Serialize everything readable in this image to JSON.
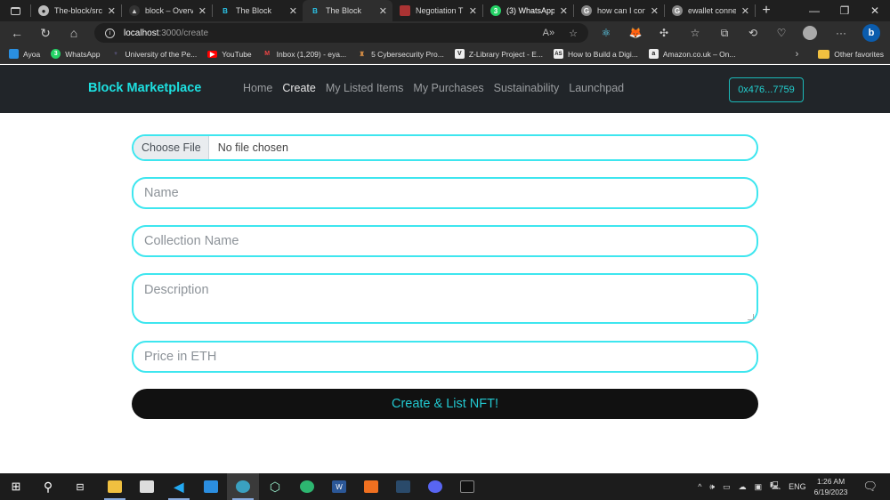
{
  "browser": {
    "tabs": [
      {
        "label": "The-block/src",
        "icon": "github-icon",
        "active": false
      },
      {
        "label": "block – Overv",
        "icon": "vercel-icon",
        "active": false
      },
      {
        "label": "The Block",
        "icon": "block-b-icon",
        "active": false
      },
      {
        "label": "The Block",
        "icon": "block-b-icon",
        "active": true
      },
      {
        "label": "Negotiation T",
        "icon": "doc-icon",
        "active": false
      },
      {
        "label": "(3) WhatsApp",
        "icon": "whatsapp-icon",
        "active": false
      },
      {
        "label": "how can I con",
        "icon": "google-icon",
        "active": false
      },
      {
        "label": "ewallet conne",
        "icon": "google-icon",
        "active": false
      }
    ],
    "url_host": "localhost",
    "url_path": ":3000/create",
    "bookmarks": [
      {
        "label": "Ayoa",
        "color": "#2a8fe0"
      },
      {
        "label": "WhatsApp",
        "color": "#25d366"
      },
      {
        "label": "University of the Pe...",
        "color": "#8a7fd0"
      },
      {
        "label": "YouTube",
        "color": "#ff0000"
      },
      {
        "label": "Inbox (1,209) - eya...",
        "color": "#d44"
      },
      {
        "label": "5 Cybersecurity Pro...",
        "color": "#c84"
      },
      {
        "label": "Z-Library Project - E...",
        "color": "#eee"
      },
      {
        "label": "How to Build a Digi...",
        "color": "#eee"
      },
      {
        "label": "Amazon.co.uk – On...",
        "color": "#eee"
      }
    ],
    "other_favorites": "Other favorites"
  },
  "site": {
    "brand": "Block Marketplace",
    "nav": [
      {
        "label": "Home",
        "current": false
      },
      {
        "label": "Create",
        "current": true
      },
      {
        "label": "My Listed Items",
        "current": false
      },
      {
        "label": "My Purchases",
        "current": false
      },
      {
        "label": "Sustainability",
        "current": false
      },
      {
        "label": "Launchpad",
        "current": false
      }
    ],
    "wallet": "0x476...7759",
    "accent": "#1de0e0"
  },
  "form": {
    "file_button": "Choose File",
    "file_status": "No file chosen",
    "name_placeholder": "Name",
    "collection_placeholder": "Collection Name",
    "description_placeholder": "Description",
    "price_placeholder": "Price in ETH",
    "submit": "Create & List NFT!"
  },
  "taskbar": {
    "lang": "ENG",
    "time": "1:26 AM",
    "date": "6/19/2023"
  }
}
